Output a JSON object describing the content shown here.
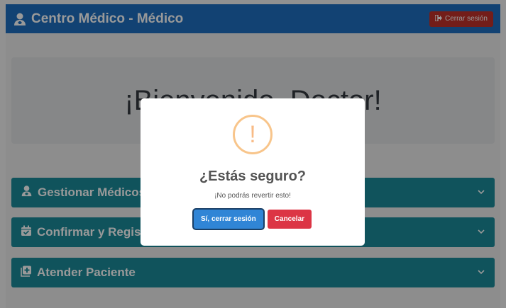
{
  "header": {
    "title": "Centro Médico - Médico",
    "logout_label": "Cerrar sesión"
  },
  "welcome": {
    "text": "¡Bienvenido, Doctor!"
  },
  "sections": [
    {
      "label": "Gestionar Médicos",
      "icon": "user-doctor-icon"
    },
    {
      "label": "Confirmar y Registrar Cita",
      "icon": "calendar-check-icon"
    },
    {
      "label": "Atender Paciente",
      "icon": "clipboard-medical-icon"
    }
  ],
  "modal": {
    "icon_glyph": "!",
    "title": "¿Estás seguro?",
    "message": "¡No podrás revertir esto!",
    "confirm_label": "Sí, cerrar sesión",
    "cancel_label": "Cancelar"
  },
  "colors": {
    "navbar": "#1f6fc0",
    "logout": "#c0312a",
    "accordion": "#1b8a9a",
    "confirm": "#3085d6",
    "cancel": "#dc3545",
    "warning": "#f8bb86"
  }
}
